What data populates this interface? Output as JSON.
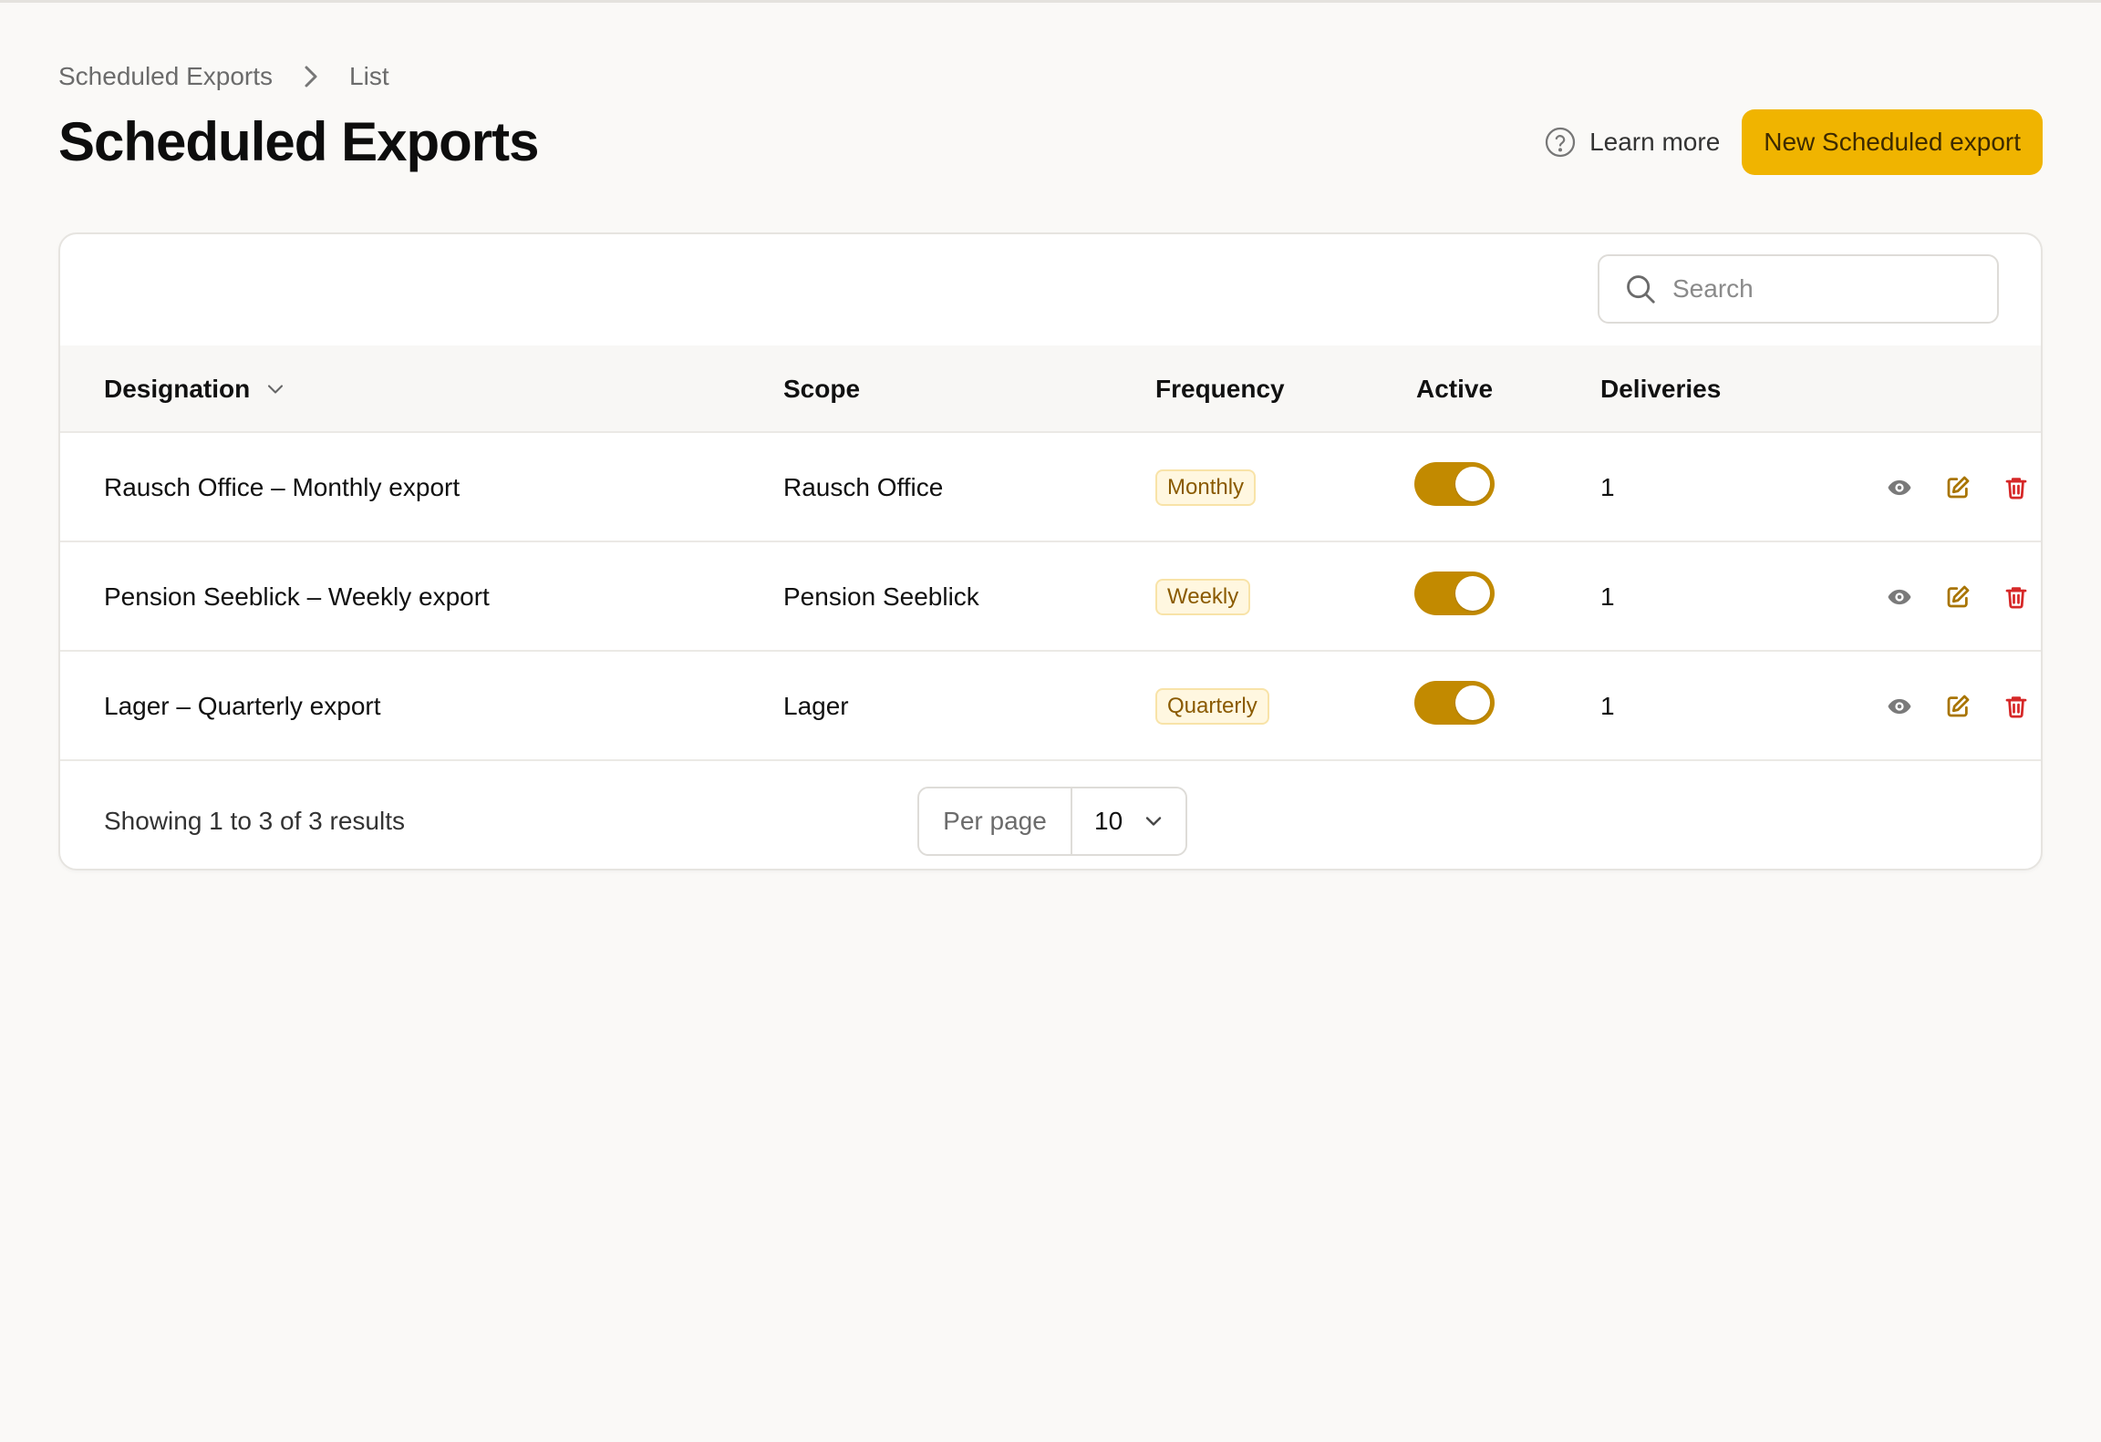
{
  "breadcrumb": {
    "root": "Scheduled Exports",
    "current": "List"
  },
  "header": {
    "title": "Scheduled Exports",
    "learn_more": "Learn more",
    "new_button": "New Scheduled export"
  },
  "search": {
    "placeholder": "Search",
    "value": ""
  },
  "table": {
    "columns": {
      "designation": "Designation",
      "scope": "Scope",
      "frequency": "Frequency",
      "active": "Active",
      "deliveries": "Deliveries"
    },
    "rows": [
      {
        "designation": "Rausch Office – Monthly export",
        "scope": "Rausch Office",
        "frequency": "Monthly",
        "active": true,
        "deliveries": "1"
      },
      {
        "designation": "Pension Seeblick – Weekly export",
        "scope": "Pension Seeblick",
        "frequency": "Weekly",
        "active": true,
        "deliveries": "1"
      },
      {
        "designation": "Lager – Quarterly export",
        "scope": "Lager",
        "frequency": "Quarterly",
        "active": true,
        "deliveries": "1"
      }
    ]
  },
  "footer": {
    "results": "Showing 1 to 3 of 3 results",
    "per_page_label": "Per page",
    "per_page_value": "10"
  },
  "icons": {
    "breadcrumb_separator": "chevron-right-icon",
    "help": "question-circle-icon",
    "search": "search-icon",
    "sort": "chevron-down-icon",
    "view": "eye-icon",
    "edit": "edit-icon",
    "delete": "trash-icon"
  },
  "colors": {
    "primary": "#f0b400",
    "toggle_on": "#c28a00",
    "badge_bg": "#fff7e0",
    "badge_text": "#8a5a00",
    "edit": "#a87400",
    "delete": "#d62828",
    "view": "#7a7a7a"
  }
}
